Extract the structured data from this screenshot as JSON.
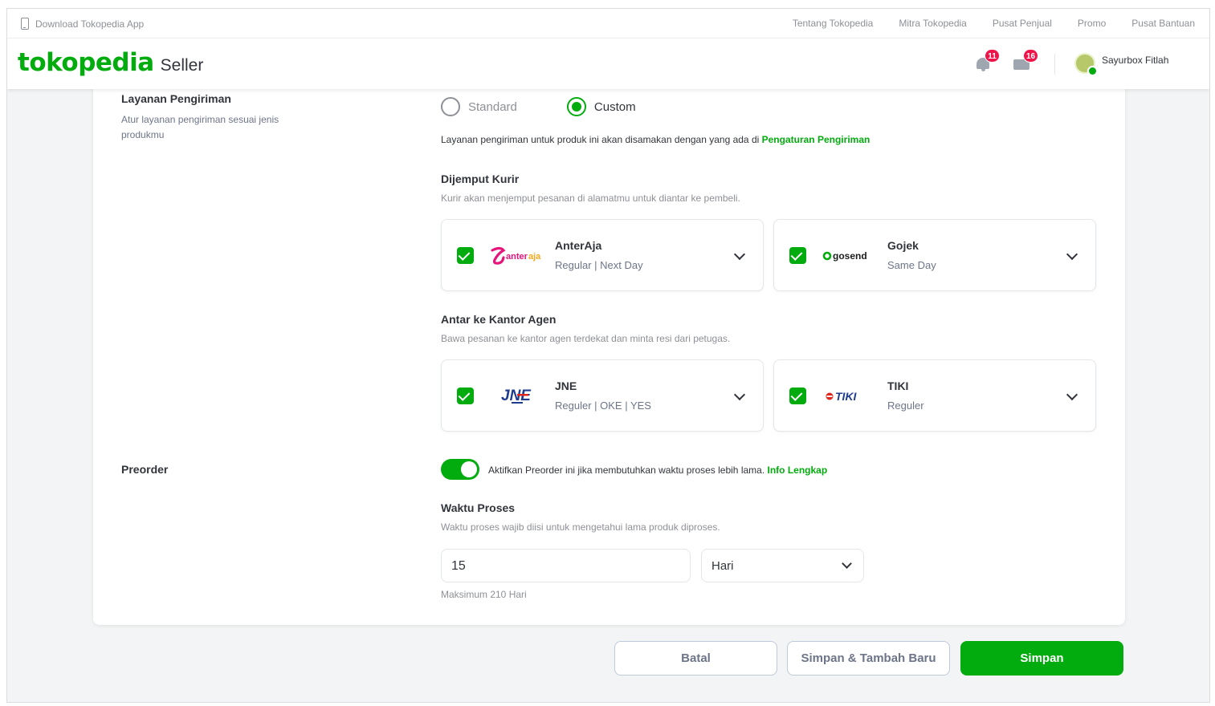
{
  "topbar": {
    "download_label": "Download Tokopedia App",
    "links": [
      "Tentang Tokopedia",
      "Mitra Tokopedia",
      "Pusat Penjual",
      "Promo",
      "Pusat Bantuan"
    ]
  },
  "header": {
    "brand": "tokopedia",
    "product": "Seller",
    "notifications_count": "11",
    "messages_count": "16",
    "user_name": "Sayurbox Fitlah"
  },
  "shipping": {
    "label": "Layanan Pengiriman",
    "description": "Atur layanan pengiriman sesuai jenis produkmu",
    "option_standard": "Standard",
    "option_custom": "Custom",
    "selected_option": "Custom",
    "note_text": "Layanan pengiriman untuk produk ini akan disamakan dengan yang ada di ",
    "note_link": "Pengaturan Pengiriman",
    "pickup": {
      "title": "Dijemput Kurir",
      "subtitle": "Kurir akan menjemput pesanan di alamatmu untuk diantar ke pembeli.",
      "couriers": [
        {
          "name": "AnterAja",
          "services": "Regular | Next Day",
          "logo_text": "anteraja",
          "checked": true
        },
        {
          "name": "Gojek",
          "services": "Same Day",
          "logo_text": "gosend",
          "checked": true
        }
      ]
    },
    "dropoff": {
      "title": "Antar ke Kantor Agen",
      "subtitle": "Bawa pesanan ke kantor agen terdekat dan minta resi dari petugas.",
      "couriers": [
        {
          "name": "JNE",
          "services": "Reguler | OKE | YES",
          "logo_text": "JNE",
          "checked": true
        },
        {
          "name": "TIKI",
          "services": "Reguler",
          "logo_text": "TIKI",
          "checked": true
        }
      ]
    }
  },
  "preorder": {
    "label": "Preorder",
    "enabled": true,
    "toggle_text": "Aktifkan Preorder ini jika membutuhkan waktu proses lebih lama. ",
    "info_link": "Info Lengkap",
    "process_title": "Waktu Proses",
    "process_subtitle": "Waktu proses wajib diisi untuk mengetahui lama produk diproses.",
    "process_value": "15",
    "unit_value": "Hari",
    "max_note": "Maksimum 210 Hari"
  },
  "footer": {
    "cancel_label": "Batal",
    "save_add_label": "Simpan & Tambah Baru",
    "save_label": "Simpan"
  },
  "colors": {
    "accent": "#03ac0e",
    "badge": "#ef144a",
    "anteraja": "#e6157b",
    "jne": "#1f3c8e",
    "tiki": "#e1251b"
  }
}
